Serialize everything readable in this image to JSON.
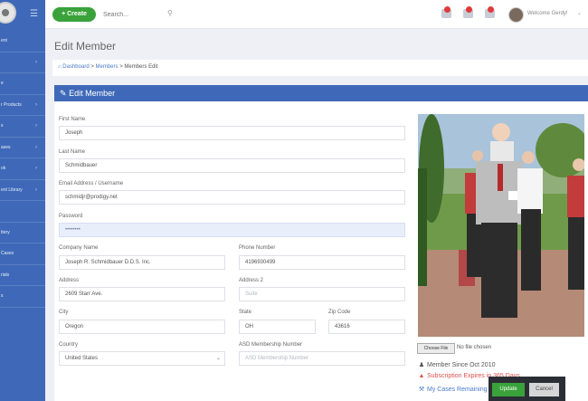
{
  "sidebar": {
    "items": [
      {
        "label": "ent",
        "chevron": false,
        "active": false
      },
      {
        "label": "",
        "chevron": true,
        "active": false
      },
      {
        "label": "e",
        "chevron": false,
        "active": false
      },
      {
        "label": "r Products",
        "chevron": true,
        "active": false
      },
      {
        "label": "s",
        "chevron": true,
        "active": false
      },
      {
        "label": "ases",
        "chevron": true,
        "active": false
      },
      {
        "label": "ok",
        "chevron": true,
        "active": false
      },
      {
        "label": "ent Library",
        "chevron": true,
        "active": false
      },
      {
        "label": "",
        "chevron": false,
        "active": false
      },
      {
        "label": "ttery",
        "chevron": false,
        "active": false
      },
      {
        "label": "Cases",
        "chevron": false,
        "active": false
      },
      {
        "label": "rials",
        "chevron": false,
        "active": false
      },
      {
        "label": "s",
        "chevron": false,
        "active": false
      }
    ]
  },
  "topbar": {
    "create_label": "Create",
    "search_placeholder": "Search...",
    "welcome": "Welcome Gerdy!"
  },
  "page": {
    "title": "Edit Member",
    "breadcrumb": {
      "home": "Dashboard",
      "members": "Members",
      "current": "Members Edit",
      "sep": ">"
    }
  },
  "panel": {
    "title": "Edit Member"
  },
  "form": {
    "first_name": {
      "label": "First Name",
      "value": "Joseph"
    },
    "last_name": {
      "label": "Last Name",
      "value": "Schmidbauer"
    },
    "email": {
      "label": "Email Address / Username",
      "value": "schmidjr@prodigy.net"
    },
    "password": {
      "label": "Password",
      "value": "••••••••"
    },
    "company": {
      "label": "Company Name",
      "value": "Joseph R. Schmidbauer D.D.S. Inc."
    },
    "phone": {
      "label": "Phone Number",
      "value": "4196930499"
    },
    "address": {
      "label": "Address",
      "value": "2609 Starr Ave."
    },
    "address2": {
      "label": "Address 2",
      "placeholder": "Suite"
    },
    "city": {
      "label": "City",
      "value": "Oregon"
    },
    "state": {
      "label": "State",
      "value": "OH"
    },
    "zip": {
      "label": "Zip Code",
      "value": "43616"
    },
    "country": {
      "label": "Country",
      "value": "United States"
    },
    "asd": {
      "label": "ASD Membership Number",
      "placeholder": "ASD Membership Number"
    }
  },
  "sidebar_info": {
    "file_button": "Choose File",
    "file_status": "No file chosen",
    "member_since": "Member Since Oct 2010",
    "subscription": "Subscription Expires in 365 Days",
    "my_cases": "My Cases Remaining"
  },
  "actions": {
    "update": "Update",
    "cancel": "Cancel"
  },
  "colors": {
    "sidebar": "#3f69b8",
    "create_button": "#3aa23a",
    "update_button": "#3aa23a",
    "badge": "#e23a3a",
    "subscription_text": "#d9534f",
    "link": "#4a7ac9"
  }
}
